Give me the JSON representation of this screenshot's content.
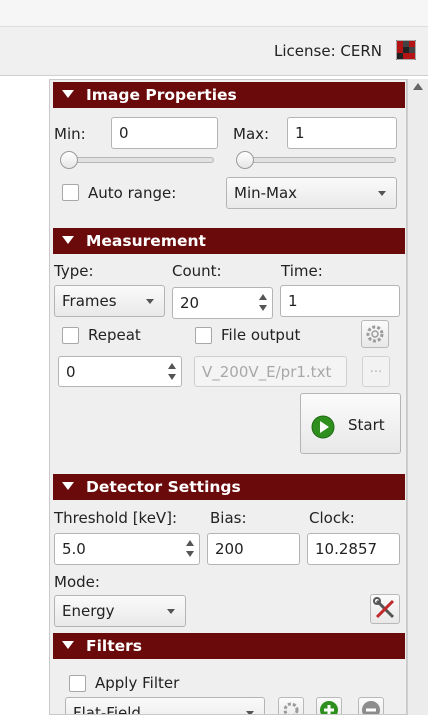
{
  "header": {
    "license": "License: CERN",
    "license_icon": "grid-icon"
  },
  "image_properties": {
    "title": "Image Properties",
    "min_label": "Min:",
    "min_value": "0",
    "max_label": "Max:",
    "max_value": "1",
    "auto_range_label": "Auto range:",
    "auto_range_checked": false,
    "range_mode": "Min-Max"
  },
  "measurement": {
    "title": "Measurement",
    "type_label": "Type:",
    "count_label": "Count:",
    "time_label": "Time:",
    "type_value": "Frames",
    "count_value": "20",
    "time_value": "1",
    "repeat_label": "Repeat",
    "repeat_checked": false,
    "file_output_label": "File output",
    "file_output_checked": false,
    "repeat_value": "0",
    "file_path": "V_200V_E/pr1.txt",
    "browse_label": "...",
    "start_label": "Start"
  },
  "detector": {
    "title": "Detector Settings",
    "threshold_label": "Threshold [keV]:",
    "bias_label": "Bias:",
    "clock_label": "Clock:",
    "threshold_value": "5.0",
    "bias_value": "200",
    "clock_value": "10.2857",
    "mode_label": "Mode:",
    "mode_value": "Energy"
  },
  "filters": {
    "title": "Filters",
    "apply_label": "Apply Filter",
    "apply_checked": false,
    "filter_value": "Flat-Field"
  },
  "colors": {
    "section_header": "#6b0a0a",
    "panel_bg": "#efefef",
    "start_green": "#2e8f1e"
  }
}
